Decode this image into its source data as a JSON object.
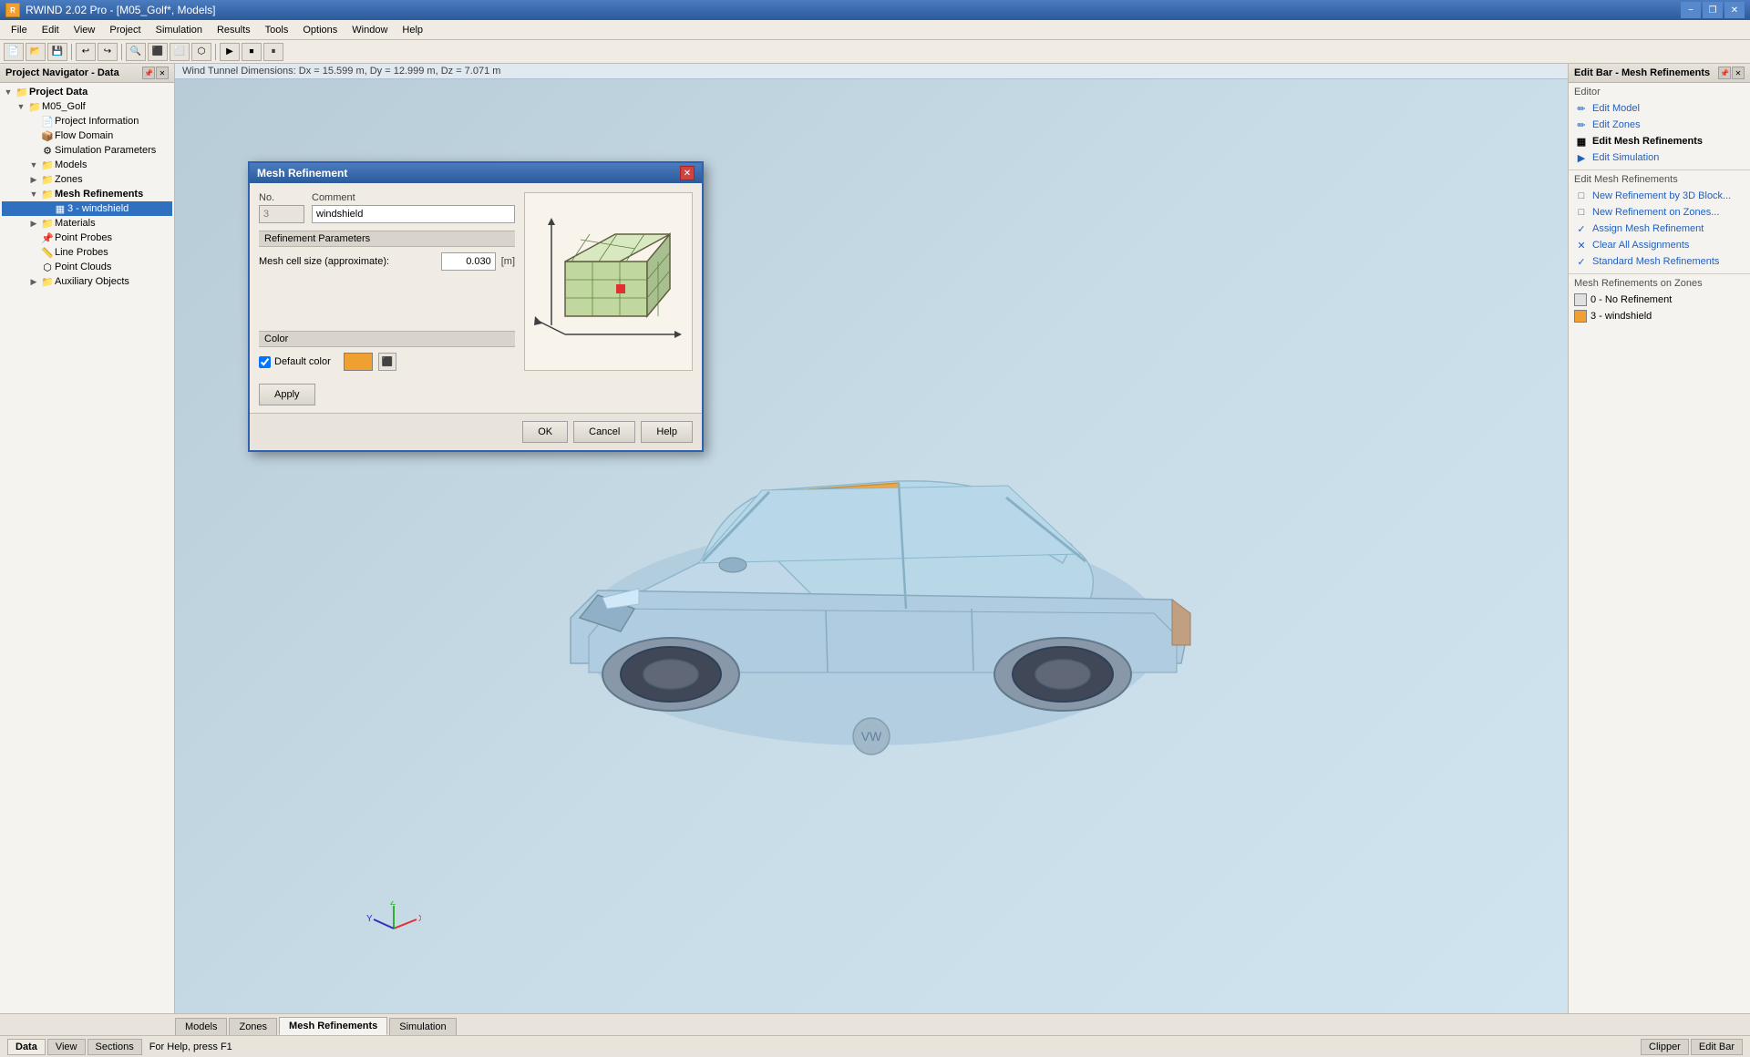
{
  "app": {
    "title": "RWIND 2.02 Pro - [M05_Golf*, Models]",
    "icon": "R"
  },
  "titlebar": {
    "minimize": "−",
    "maximize": "□",
    "close": "✕",
    "restore": "❐"
  },
  "menubar": {
    "items": [
      "File",
      "Edit",
      "View",
      "Project",
      "Simulation",
      "Results",
      "Tools",
      "Options",
      "Window",
      "Help"
    ]
  },
  "navigator": {
    "title": "Project Navigator - Data",
    "tree": [
      {
        "id": "project-data",
        "label": "Project Data",
        "indent": 0,
        "toggle": "▼",
        "icon": "📁",
        "bold": true
      },
      {
        "id": "m05-golf",
        "label": "M05_Golf",
        "indent": 1,
        "toggle": "▼",
        "icon": "📁",
        "bold": false
      },
      {
        "id": "project-info",
        "label": "Project Information",
        "indent": 2,
        "toggle": "",
        "icon": "📄",
        "bold": false
      },
      {
        "id": "flow-domain",
        "label": "Flow Domain",
        "indent": 2,
        "toggle": "",
        "icon": "📦",
        "bold": false
      },
      {
        "id": "sim-params",
        "label": "Simulation Parameters",
        "indent": 2,
        "toggle": "",
        "icon": "⚙",
        "bold": false
      },
      {
        "id": "models",
        "label": "Models",
        "indent": 2,
        "toggle": "▼",
        "icon": "📁",
        "bold": false
      },
      {
        "id": "zones",
        "label": "Zones",
        "indent": 2,
        "toggle": "▶",
        "icon": "📁",
        "bold": false
      },
      {
        "id": "mesh-refinements",
        "label": "Mesh Refinements",
        "indent": 2,
        "toggle": "▼",
        "icon": "📁",
        "bold": true
      },
      {
        "id": "3-windshield",
        "label": "3 - windshield",
        "indent": 3,
        "toggle": "",
        "icon": "▦",
        "bold": false,
        "selected": true
      },
      {
        "id": "materials",
        "label": "Materials",
        "indent": 2,
        "toggle": "▶",
        "icon": "📁",
        "bold": false
      },
      {
        "id": "point-probes",
        "label": "Point Probes",
        "indent": 2,
        "toggle": "",
        "icon": "📌",
        "bold": false
      },
      {
        "id": "line-probes",
        "label": "Line Probes",
        "indent": 2,
        "toggle": "",
        "icon": "📏",
        "bold": false
      },
      {
        "id": "point-clouds",
        "label": "Point Clouds",
        "indent": 2,
        "toggle": "",
        "icon": "⬡",
        "bold": false
      },
      {
        "id": "auxiliary-objects",
        "label": "Auxiliary Objects",
        "indent": 2,
        "toggle": "▶",
        "icon": "📁",
        "bold": false
      }
    ]
  },
  "viewport": {
    "tunnel_dims": "Wind Tunnel Dimensions: Dx = 15.599 m, Dy = 12.999 m, Dz = 7.071 m"
  },
  "dialog": {
    "title": "Mesh Refinement",
    "field_no_label": "No.",
    "field_no_value": "3",
    "field_comment_label": "Comment",
    "field_comment_value": "windshield",
    "section_params": "Refinement Parameters",
    "mesh_cell_label": "Mesh cell size (approximate):",
    "mesh_cell_value": "0.030",
    "mesh_cell_unit": "[m]",
    "section_color": "Color",
    "default_color_label": "Default color",
    "default_color_checked": true,
    "btn_apply": "Apply",
    "btn_ok": "OK",
    "btn_cancel": "Cancel",
    "btn_help": "Help"
  },
  "right_panel": {
    "title": "Edit Bar - Mesh Refinements",
    "section_editor": "Editor",
    "links": [
      {
        "id": "edit-model",
        "label": "Edit Model",
        "icon": "🖊"
      },
      {
        "id": "edit-zones",
        "label": "Edit Zones",
        "icon": "🖊"
      },
      {
        "id": "edit-mesh-refinements",
        "label": "Edit Mesh Refinements",
        "icon": "▦",
        "active": true
      },
      {
        "id": "edit-simulation",
        "label": "Edit Simulation",
        "icon": "▶"
      }
    ],
    "section_edit_mesh": "Edit Mesh Refinements",
    "mesh_links": [
      {
        "id": "new-3d-block",
        "label": "New Refinement by 3D Block...",
        "icon": "□"
      },
      {
        "id": "new-zones",
        "label": "New Refinement on Zones...",
        "icon": "□"
      },
      {
        "id": "assign-mesh",
        "label": "Assign Mesh Refinement",
        "icon": "✓"
      },
      {
        "id": "clear-assignments",
        "label": "Clear All Assignments",
        "icon": "✕"
      },
      {
        "id": "standard-mesh",
        "label": "Standard Mesh Refinements",
        "icon": "✓"
      }
    ],
    "section_zones": "Mesh Refinements on Zones",
    "zones": [
      {
        "id": "zone-0",
        "label": "0 - No Refinement",
        "color": "#e0e0e0"
      },
      {
        "id": "zone-3",
        "label": "3 - windshield",
        "color": "#f0a030"
      }
    ]
  },
  "bottom_tabs": [
    {
      "id": "models",
      "label": "Models"
    },
    {
      "id": "zones",
      "label": "Zones"
    },
    {
      "id": "mesh-refinements",
      "label": "Mesh Refinements",
      "active": true
    },
    {
      "id": "simulation",
      "label": "Simulation"
    }
  ],
  "status_bar": {
    "tabs": [
      {
        "id": "data",
        "label": "Data",
        "active": true
      },
      {
        "id": "view",
        "label": "View"
      },
      {
        "id": "sections",
        "label": "Sections"
      }
    ],
    "message": "For Help, press F1",
    "right_tabs": [
      {
        "id": "clipper",
        "label": "Clipper"
      },
      {
        "id": "edit-bar",
        "label": "Edit Bar"
      }
    ]
  }
}
